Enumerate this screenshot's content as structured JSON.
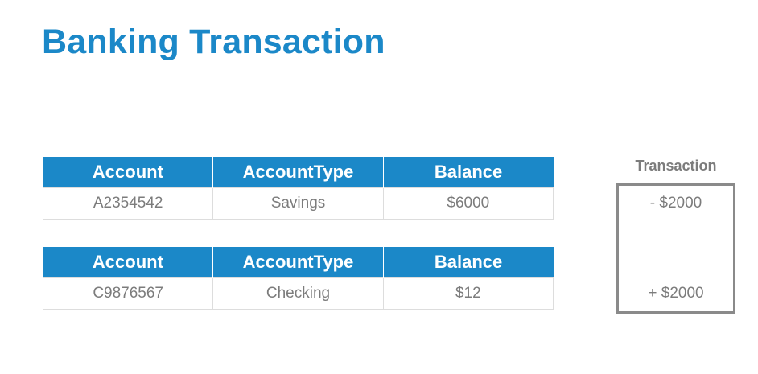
{
  "title": "Banking Transaction",
  "tables": [
    {
      "headers": [
        "Account",
        "AccountType",
        "Balance"
      ],
      "rows": [
        [
          "A2354542",
          "Savings",
          "$6000"
        ]
      ]
    },
    {
      "headers": [
        "Account",
        "AccountType",
        "Balance"
      ],
      "rows": [
        [
          "C9876567",
          "Checking",
          "$12"
        ]
      ]
    }
  ],
  "transaction": {
    "label": "Transaction",
    "debit": "- $2000",
    "credit": "+ $2000"
  },
  "colors": {
    "accent": "#1b88c8",
    "text_gray": "#7c7c7c",
    "box_border": "#8a8a8a"
  }
}
